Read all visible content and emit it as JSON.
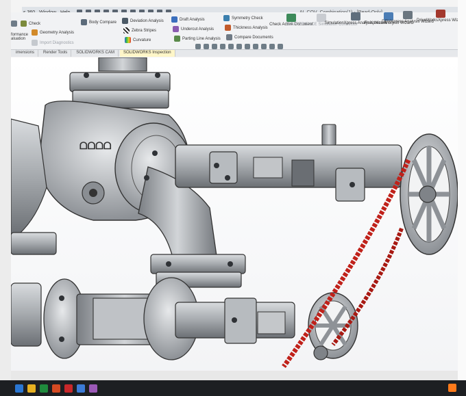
{
  "window": {
    "menu": [
      "s 360",
      "Window",
      "Help"
    ],
    "doc_title": "AI_COV_Combination(1) - [Read-Only]"
  },
  "ribbon": {
    "col1": [
      "Check",
      "Geometry Analysis",
      "Import Diagnostics"
    ],
    "col1_left": [
      "formance",
      "aluation"
    ],
    "body_compare": "Body Compare",
    "col3": [
      "Deviation Analysis",
      "Zebra Stripes",
      "Curvature"
    ],
    "col4": [
      "Draft Analysis",
      "Undercut Analysis",
      "Parting Line Analysis"
    ],
    "col5": [
      "Symmetry Check",
      "Thickness Analysis",
      "Compare Documents"
    ],
    "big": [
      {
        "label": "Check Active Document",
        "icon": "check-document-icon"
      },
      {
        "label": "3DEXPERIENCE Simulation Connector",
        "icon": "simulation-connector-icon"
      },
      {
        "label": "SimulationXpress Analysis Wizard",
        "icon": "simulationxpress-icon"
      },
      {
        "label": "FloXpress Analysis Wizard",
        "icon": "floxpress-icon"
      },
      {
        "label": "DFMXpress Analysis Wizard",
        "icon": "dfmxpress-icon"
      },
      {
        "label": "DriveWorksXpress Wizard",
        "icon": "driveworksxpress-icon"
      }
    ]
  },
  "tabs": [
    "imensions",
    "Render Tools",
    "SOLIDWORKS CAM",
    "SOLIDWORKS Inspection"
  ],
  "active_tab": 3,
  "colors": {
    "ribbon_bg": "#f1f2f4",
    "active_tab": "#fff6c8",
    "chain": "#c0211a",
    "metal": "#a9adb1",
    "taskbar": "#1d1f22"
  }
}
